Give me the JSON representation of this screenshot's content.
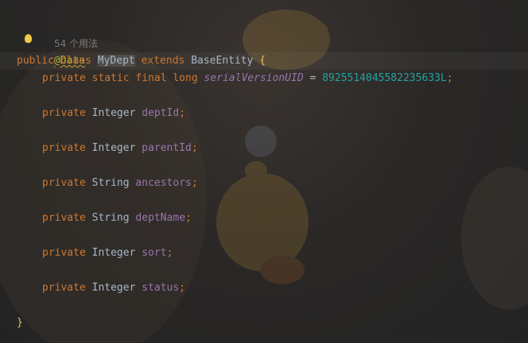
{
  "editor": {
    "usage_hint": "54 个用法",
    "annotation": "@Data",
    "class_decl": {
      "kw_public": "public",
      "kw_class": "class",
      "class_name": "MyDept",
      "kw_extends": "extends",
      "super_class": "BaseEntity",
      "open_brace": "{"
    },
    "serial": {
      "modifiers": "private static final long",
      "name": "serialVersionUID",
      "equals": "=",
      "value": "8925514045582235633L",
      "semicolon": ";"
    },
    "fields": [
      {
        "modifier": "private",
        "type": "Integer",
        "name": "deptId",
        "semicolon": ";"
      },
      {
        "modifier": "private",
        "type": "Integer",
        "name": "parentId",
        "semicolon": ";"
      },
      {
        "modifier": "private",
        "type": "String",
        "name": "ancestors",
        "semicolon": ";"
      },
      {
        "modifier": "private",
        "type": "String",
        "name": "deptName",
        "semicolon": ";"
      },
      {
        "modifier": "private",
        "type": "Integer",
        "name": "sort",
        "semicolon": ";"
      },
      {
        "modifier": "private",
        "type": "Integer",
        "name": "status",
        "semicolon": ";"
      }
    ],
    "close_brace": "}"
  },
  "colors": {
    "keyword": "#cc7832",
    "field": "#9876aa",
    "number": "#20a3a3",
    "annotation": "#bbb529",
    "text": "#a9b7c6"
  },
  "icons": {
    "intention_bulb": "lightbulb-icon",
    "background": "rubber-duck-wallpaper"
  }
}
